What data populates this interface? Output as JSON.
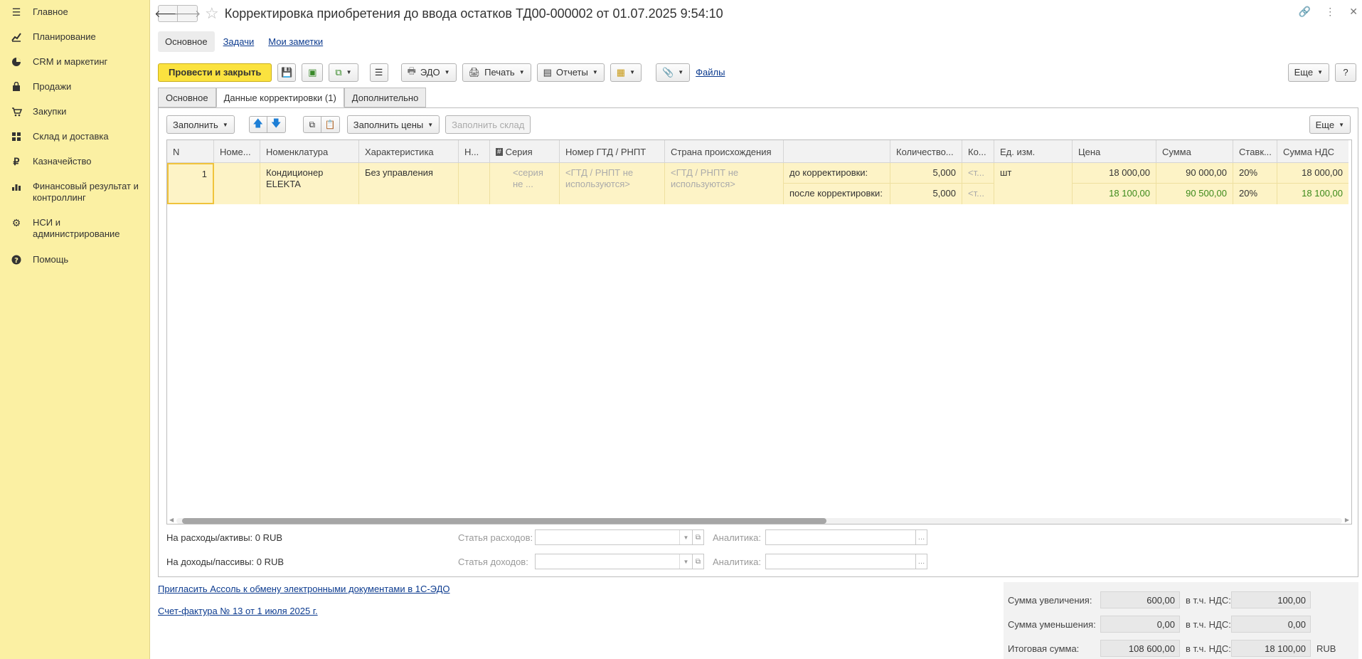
{
  "sidebar": {
    "items": [
      {
        "label": "Главное",
        "icon": "menu-icon"
      },
      {
        "label": "Планирование",
        "icon": "chart-line-icon"
      },
      {
        "label": "CRM и маркетинг",
        "icon": "pie-icon"
      },
      {
        "label": "Продажи",
        "icon": "bag-icon"
      },
      {
        "label": "Закупки",
        "icon": "cart-icon"
      },
      {
        "label": "Склад и доставка",
        "icon": "grid-icon"
      },
      {
        "label": "Казначейство",
        "icon": "ruble-icon"
      },
      {
        "label": "Финансовый результат и контроллинг",
        "icon": "bar-chart-icon"
      },
      {
        "label": "НСИ и администрирование",
        "icon": "gear-icon"
      },
      {
        "label": "Помощь",
        "icon": "help-icon"
      }
    ]
  },
  "header": {
    "title": "Корректировка приобретения до ввода остатков ТД00-000002 от 01.07.2025 9:54:10"
  },
  "top_links": {
    "active": "Основное",
    "tasks": "Задачи",
    "notes": "Мои заметки"
  },
  "toolbar": {
    "post_close": "Провести и закрыть",
    "edo": "ЭДО",
    "print": "Печать",
    "reports": "Отчеты",
    "files": "Файлы",
    "more": "Еще",
    "help": "?"
  },
  "tabs": [
    "Основное",
    "Данные корректировки (1)",
    "Дополнительно"
  ],
  "table_toolbar": {
    "fill": "Заполнить",
    "fill_prices": "Заполнить цены",
    "fill_warehouse": "Заполнить склад",
    "more": "Еще"
  },
  "table": {
    "headers": [
      "N",
      "Номе...",
      "Номенклатура",
      "Характеристика",
      "Н...",
      "Серия",
      "Номер ГТД / РНПТ",
      "Страна происхождения",
      "",
      "Количество...",
      "Ко...",
      "Ед. изм.",
      "Цена",
      "Сумма",
      "Ставк...",
      "Сумма НДС"
    ],
    "row": {
      "n": "1",
      "item": "Кондиционер ELEKTA",
      "characteristic": "Без управления",
      "series": "<серия не ...",
      "gtd": "<ГТД / РНПТ не используются>",
      "country": "<ГТД / РНПТ не используются>",
      "before_label": "до корректировки:",
      "after_label": "после корректировки:",
      "qty_before": "5,000",
      "qty_after": "5,000",
      "ko_before": "<т...",
      "ko_after": "<т...",
      "unit": "шт",
      "price_before": "18 000,00",
      "price_after": "18 100,00",
      "sum_before": "90 000,00",
      "sum_after": "90 500,00",
      "rate_before": "20%",
      "rate_after": "20%",
      "vat_before": "18 000,00",
      "vat_after": "18 100,00"
    }
  },
  "bottom": {
    "expenses": "На расходы/активы: 0 RUB",
    "incomes": "На доходы/пассивы: 0 RUB",
    "expense_item_label": "Статья расходов:",
    "income_item_label": "Статья доходов:",
    "analytics_label": "Аналитика:"
  },
  "footer_links": {
    "invite": "Пригласить Ассоль к обмену электронными документами в 1С-ЭДО",
    "invoice": "Счет-фактура № 13 от 1 июля 2025 г."
  },
  "totals": {
    "increase_label": "Сумма увеличения:",
    "increase": "600,00",
    "increase_vat": "100,00",
    "decrease_label": "Сумма уменьшения:",
    "decrease": "0,00",
    "decrease_vat": "0,00",
    "total_label": "Итоговая сумма:",
    "total": "108 600,00",
    "total_vat": "18 100,00",
    "vat_label": "в т.ч. НДС:",
    "currency": "RUB"
  }
}
